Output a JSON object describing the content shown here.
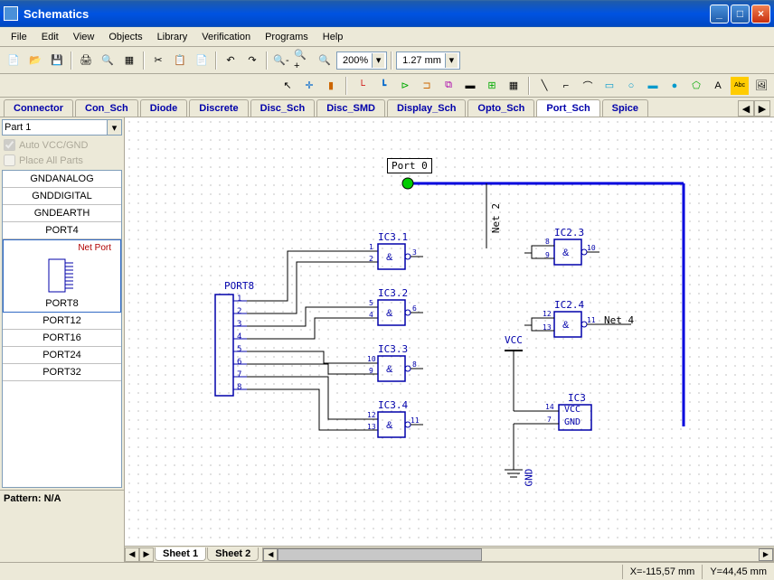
{
  "window": {
    "title": "Schematics"
  },
  "menu": [
    "File",
    "Edit",
    "View",
    "Objects",
    "Library",
    "Verification",
    "Programs",
    "Help"
  ],
  "toolbar": {
    "zoom": "200%",
    "grid": "1.27 mm"
  },
  "categories": [
    "Connector",
    "Con_Sch",
    "Diode",
    "Discrete",
    "Disc_Sch",
    "Disc_SMD",
    "Display_Sch",
    "Opto_Sch",
    "Port_Sch",
    "Spice"
  ],
  "active_category": "Port_Sch",
  "sidebar": {
    "part_selector": "Part 1",
    "auto_vcc": "Auto VCC/GND",
    "place_all": "Place All Parts",
    "parts": [
      "GNDANALOG",
      "GNDDIGITAL",
      "GNDEARTH",
      "PORT4",
      "PORT8",
      "PORT12",
      "PORT16",
      "PORT24",
      "PORT32"
    ],
    "selected_part": "PORT8",
    "netport_label": "Net Port",
    "pattern": "Pattern: N/A"
  },
  "canvas": {
    "port0_label": "Port 0",
    "port8_label": "PORT8",
    "port8_pins": [
      "1",
      "2",
      "3",
      "4",
      "5",
      "6",
      "7",
      "8"
    ],
    "gates": {
      "ic31": "IC3.1",
      "ic32": "IC3.2",
      "ic33": "IC3.3",
      "ic34": "IC3.4",
      "ic23": "IC2.3",
      "ic24": "IC2.4",
      "ic3": "IC3"
    },
    "vcc": "VCC",
    "gnd": "GND",
    "net2": "Net 2",
    "net4": "Net 4",
    "ic3_vcc": "VCC",
    "ic3_gnd": "GND",
    "pins": {
      "p1": "1",
      "p2": "2",
      "p3": "3",
      "p4": "4",
      "p5": "5",
      "p6": "6",
      "p7": "7",
      "p8": "8",
      "p9": "9",
      "p10": "10",
      "p11": "11",
      "p12": "12",
      "p13": "13",
      "p14": "14"
    },
    "amp": "&"
  },
  "sheets": [
    "Sheet 1",
    "Sheet 2"
  ],
  "active_sheet": "Sheet 1",
  "status": {
    "x": "X=-115,57 mm",
    "y": "Y=44,45 mm"
  }
}
